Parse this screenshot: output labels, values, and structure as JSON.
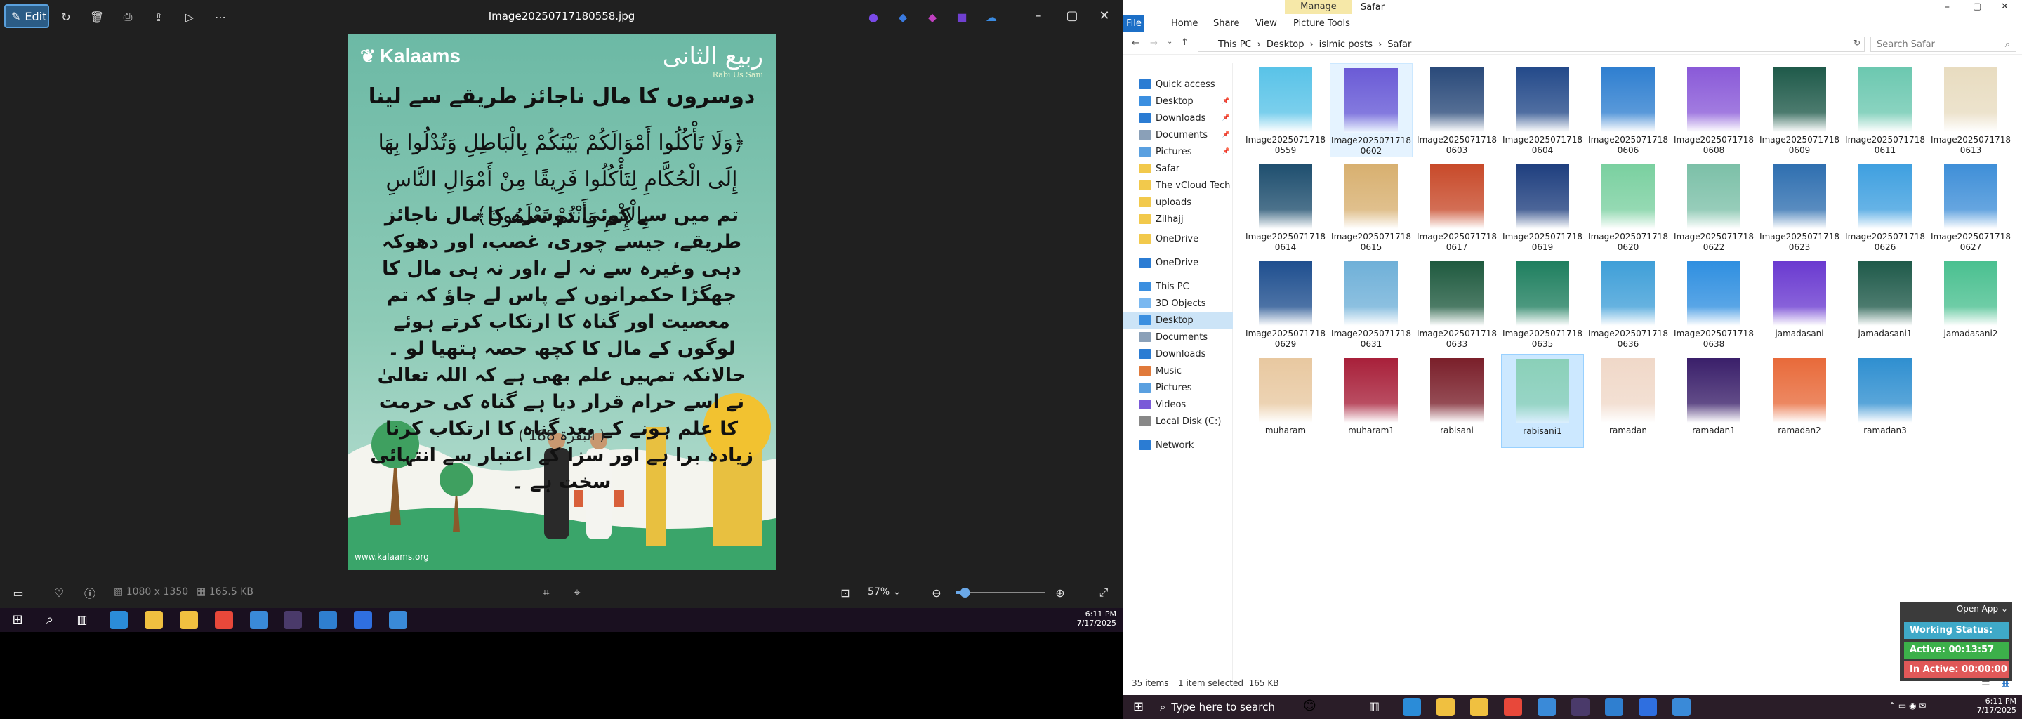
{
  "photos": {
    "edit_label": "Edit",
    "file_name": "Image20250717180558.jpg",
    "dimensions": "1080 x 1350",
    "file_size": "165.5 KB",
    "zoom": "57%",
    "zoom_fraction": 0.1
  },
  "poster": {
    "brand": "Kalaams",
    "month": "ربیع الثانی",
    "month_sub": "Rabi Us Sani",
    "heading": "دوسروں کا مال ناجائز طریقے سے لینا",
    "ayah": "﴿وَلَا تَأْكُلُوا أَمْوَالَكُمْ بَيْنَكُمْ بِالْبَاطِلِ وَتُدْلُوا بِهَا إِلَى الْحُكَّامِ لِتَأْكُلُوا فَرِيقًا مِنْ أَمْوَالِ النَّاسِ بِالْإِثْمِ وَأَنْتُمْ تَعْلَمُونَ﴾",
    "body": "تم میں سے کوئی دوسرے کا مال ناجائز طریقے، جیسے چوری، غصب، اور دھوکہ دہی وغیرہ سے نہ لے ،اور نہ ہی مال کا جھگڑا حکمرانوں کے پاس لے جاؤ کہ تم معصیت اور گناہ کا ارتکاب کرتے ہوئے لوگوں کے مال کا کچھ حصہ ہتھیا لو ۔ حالانکہ تمہیں علم بھی ہے کہ اللہ تعالیٰ نے اسے حرام قرار دیا ہے گناہ کی حرمت کا علم ہونے کے بعد گناہ کا ارتکاب کرنا زیادہ برا ہے اور سزا کے اعتبار سے انتہائی سخت ہے ۔",
    "reference": "( البقرۃ 188 )",
    "url": "www.kalaams.org"
  },
  "explorer": {
    "title": "Safar",
    "tabs": [
      "File",
      "Home",
      "Share",
      "View",
      "Picture Tools"
    ],
    "manage": "Manage",
    "breadcrumb": [
      "This PC",
      "Desktop",
      "islmic posts",
      "Safar"
    ],
    "search_placeholder": "Search Safar",
    "nav": [
      {
        "label": "Quick access",
        "color": "#2b7cd3"
      },
      {
        "label": "Desktop",
        "color": "#3b8fe0",
        "pin": true
      },
      {
        "label": "Downloads",
        "color": "#2b7cd3",
        "pin": true
      },
      {
        "label": "Documents",
        "color": "#8aa0b8",
        "pin": true
      },
      {
        "label": "Pictures",
        "color": "#5aa0e0",
        "pin": true
      },
      {
        "label": "Safar",
        "color": "#f2c94c"
      },
      {
        "label": "The vCloud Tech Blog",
        "color": "#f2c94c"
      },
      {
        "label": "uploads",
        "color": "#f2c94c"
      },
      {
        "label": "Zilhajj",
        "color": "#f2c94c"
      },
      {
        "label": "OneDrive",
        "color": "#f2c94c"
      },
      {
        "label": "OneDrive",
        "color": "#2b7cd3"
      },
      {
        "label": "This PC",
        "color": "#3b8fe0"
      },
      {
        "label": "3D Objects",
        "color": "#7ab8f0"
      },
      {
        "label": "Desktop",
        "color": "#3b8fe0",
        "selected": true
      },
      {
        "label": "Documents",
        "color": "#8aa0b8"
      },
      {
        "label": "Downloads",
        "color": "#2b7cd3"
      },
      {
        "label": "Music",
        "color": "#e07a3b"
      },
      {
        "label": "Pictures",
        "color": "#5aa0e0"
      },
      {
        "label": "Videos",
        "color": "#7a5ad8"
      },
      {
        "label": "Local Disk (C:)",
        "color": "#888888"
      },
      {
        "label": "Network",
        "color": "#2b7cd3"
      }
    ],
    "files": [
      {
        "name": "Image2025071718\n0559",
        "color": "#59c3e8"
      },
      {
        "name": "Image2025071718\n0602",
        "color": "#6b5bd6",
        "highlight": true
      },
      {
        "name": "Image2025071718\n0603",
        "color": "#2a4a7a"
      },
      {
        "name": "Image2025071718\n0604",
        "color": "#244a8a"
      },
      {
        "name": "Image2025071718\n0606",
        "color": "#2f7fd0"
      },
      {
        "name": "Image2025071718\n0608",
        "color": "#8a5ad8"
      },
      {
        "name": "Image2025071718\n0609",
        "color": "#1f5a4a"
      },
      {
        "name": "Image2025071718\n0611",
        "color": "#6cc8b0"
      },
      {
        "name": "Image2025071718\n0613",
        "color": "#e8dcc0"
      },
      {
        "name": "Image2025071718\n0614",
        "color": "#1f4f6f"
      },
      {
        "name": "Image2025071718\n0615",
        "color": "#d8b070"
      },
      {
        "name": "Image2025071718\n0617",
        "color": "#c84a2a"
      },
      {
        "name": "Image2025071718\n0619",
        "color": "#1f3f7f"
      },
      {
        "name": "Image2025071718\n0620",
        "color": "#7ad0a0"
      },
      {
        "name": "Image2025071718\n0622",
        "color": "#7cc0a8"
      },
      {
        "name": "Image2025071718\n0623",
        "color": "#2f6fb0"
      },
      {
        "name": "Image2025071718\n0626",
        "color": "#3fa0e0"
      },
      {
        "name": "Image2025071718\n0627",
        "color": "#3f8fd8"
      },
      {
        "name": "Image2025071718\n0629",
        "color": "#1f4f8f"
      },
      {
        "name": "Image2025071718\n0631",
        "color": "#6fb0d8"
      },
      {
        "name": "Image2025071718\n0633",
        "color": "#1f5a3f"
      },
      {
        "name": "Image2025071718\n0635",
        "color": "#1f7f5f"
      },
      {
        "name": "Image2025071718\n0636",
        "color": "#3f9fd8"
      },
      {
        "name": "Image2025071718\n0638",
        "color": "#2f8fe0"
      },
      {
        "name": "jamadasani",
        "color": "#6a3ad0"
      },
      {
        "name": "jamadasani1",
        "color": "#1f5a4a"
      },
      {
        "name": "jamadasani2",
        "color": "#4ac090"
      },
      {
        "name": "muharam",
        "color": "#e8c8a0"
      },
      {
        "name": "muharam1",
        "color": "#a8203a"
      },
      {
        "name": "rabisani",
        "color": "#7a1f2a"
      },
      {
        "name": "rabisani1",
        "color": "#8ad0b8",
        "selected": true
      },
      {
        "name": "ramadan",
        "color": "#f0d8c8"
      },
      {
        "name": "ramadan1",
        "color": "#3a1f6a"
      },
      {
        "name": "ramadan2",
        "color": "#e86a3a"
      },
      {
        "name": "ramadan3",
        "color": "#2f8fd0"
      }
    ],
    "item_count": "35 items",
    "selection": "1 item selected  165 KB"
  },
  "monitor": {
    "open_app": "Open App",
    "working": "Working Status: Active",
    "active": "Active: 00:13:57",
    "inactive": "In Active: 00:00:00",
    "colors": {
      "working": "#3fa9c8",
      "active": "#3cb04a",
      "inactive": "#e05858"
    }
  },
  "taskbar": {
    "search_placeholder": "Type here to search",
    "time": "6:11 PM",
    "date": "7/17/2025"
  }
}
